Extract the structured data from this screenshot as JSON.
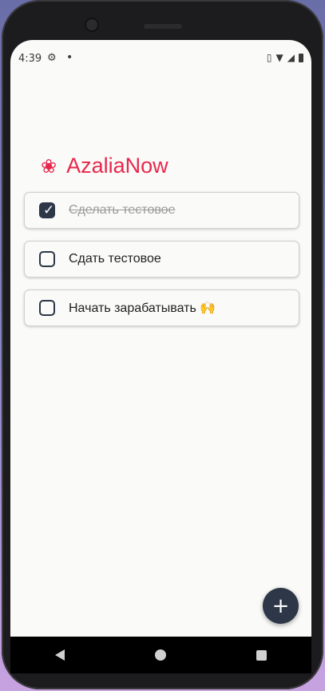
{
  "statusbar": {
    "time": "4:39",
    "icons": [
      "gear-icon",
      "notification-dot-icon",
      "vibrate-icon",
      "wifi-icon",
      "signal-icon",
      "battery-icon"
    ]
  },
  "header": {
    "logo_icon": "rose-icon",
    "title": "AzaliaNow"
  },
  "tasks": [
    {
      "label": "Сделать тестовое",
      "checked": true
    },
    {
      "label": "Сдать тестовое",
      "checked": false
    },
    {
      "label": "Начать зарабатывать 🙌",
      "checked": false
    }
  ],
  "fab": {
    "label": "+"
  },
  "navbar": {
    "icons": [
      "back-icon",
      "home-icon",
      "recents-icon"
    ]
  },
  "colors": {
    "accent": "#e8274d",
    "dark": "#2d3748",
    "background": "#fafaf8"
  }
}
